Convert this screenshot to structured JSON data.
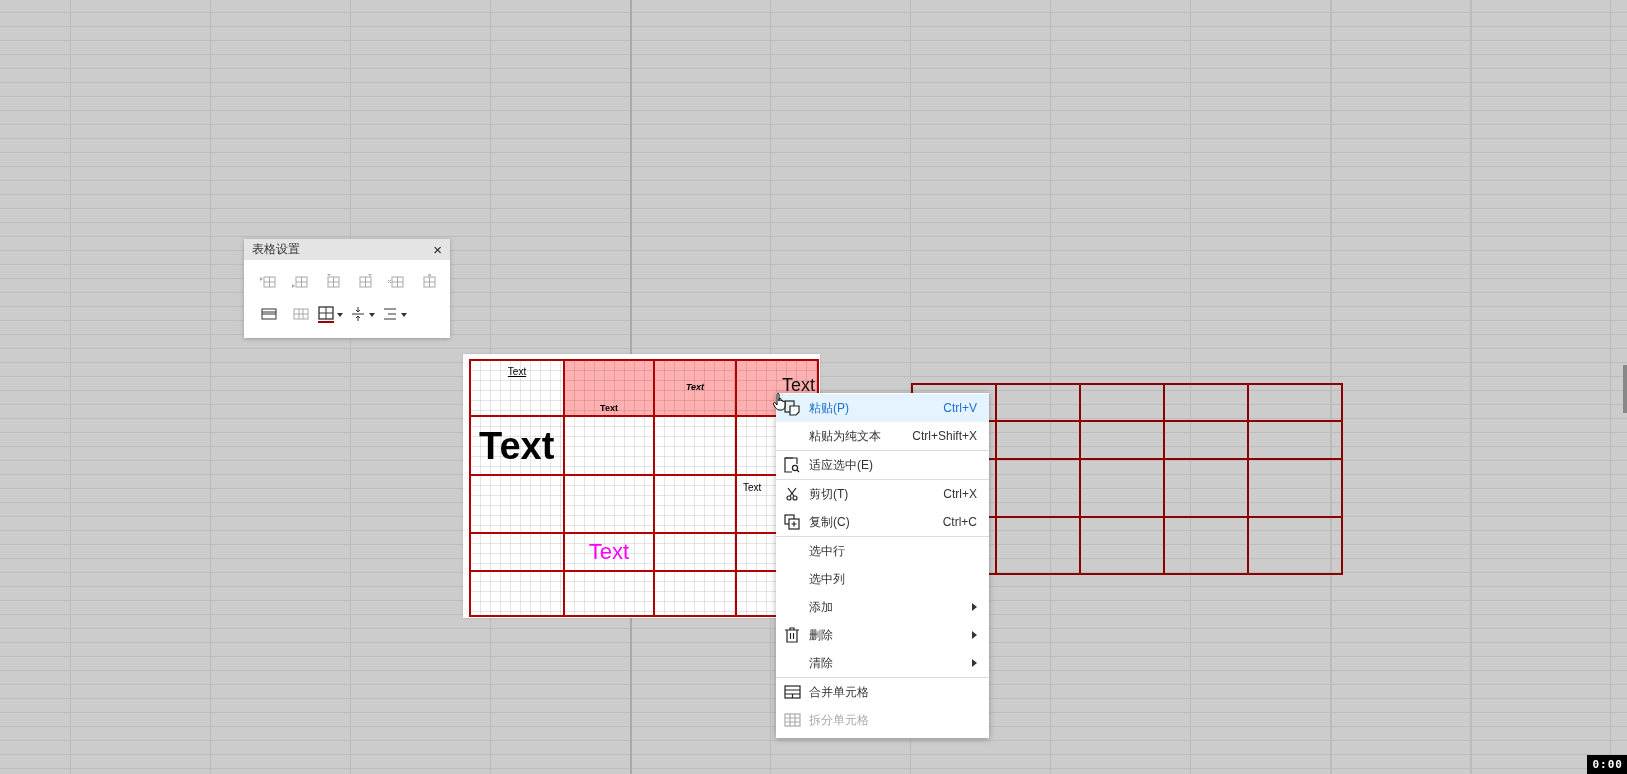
{
  "table_settings": {
    "title": "表格设置",
    "close": "×",
    "tools": [
      {
        "kind": "insert-column-left",
        "disabled": true
      },
      {
        "kind": "insert-column-right",
        "disabled": true
      },
      {
        "kind": "insert-row-above",
        "disabled": true
      },
      {
        "kind": "insert-row-below",
        "disabled": true
      },
      {
        "kind": "delete-row",
        "disabled": true
      },
      {
        "kind": "delete-column",
        "disabled": true
      },
      {
        "kind": "merge-cells",
        "disabled": false
      },
      {
        "kind": "split-cells",
        "disabled": true
      },
      {
        "kind": "borders",
        "disabled": false,
        "color": "#a00000"
      },
      {
        "kind": "vertical-align",
        "disabled": false
      },
      {
        "kind": "horizontal-align",
        "disabled": false
      }
    ]
  },
  "table": {
    "rows": [
      [
        {
          "text": "Text",
          "kind": "underlined",
          "selected": false
        },
        {
          "text": "Text",
          "kind": "bottom",
          "selected": true
        },
        {
          "text": "Text",
          "kind": "italic",
          "selected": true
        },
        {
          "text": "Text",
          "kind": "medium",
          "selected": true
        }
      ],
      [
        {
          "text": "Text",
          "kind": "huge",
          "selected": false
        },
        {
          "selected": false
        },
        {
          "selected": false
        },
        {
          "selected": false
        }
      ],
      [
        {
          "selected": false
        },
        {
          "selected": false
        },
        {
          "selected": false
        },
        {
          "text": "Text",
          "kind": "small",
          "selected": false
        }
      ],
      [
        {
          "selected": false
        },
        {
          "text": "Text",
          "kind": "magenta",
          "selected": false
        },
        {
          "selected": false
        },
        {
          "selected": false
        }
      ],
      [
        {
          "selected": false
        },
        {
          "selected": false
        },
        {
          "selected": false
        },
        {
          "selected": false
        }
      ]
    ]
  },
  "context_menu": {
    "sections": [
      [
        {
          "kind": "paste",
          "label": "粘贴(P)",
          "shortcut": "Ctrl+V",
          "selected": true,
          "disabled": false,
          "submenu": false
        },
        {
          "kind": "plain",
          "label": "粘贴为纯文本",
          "shortcut": "Ctrl+Shift+X",
          "selected": false,
          "disabled": false,
          "submenu": false
        }
      ],
      [
        {
          "kind": "fit",
          "label": "适应选中(E)",
          "selected": false,
          "disabled": false,
          "submenu": false
        }
      ],
      [
        {
          "kind": "cut",
          "label": "剪切(T)",
          "shortcut": "Ctrl+X",
          "selected": false,
          "disabled": false,
          "submenu": false
        },
        {
          "kind": "copy",
          "label": "复制(C)",
          "shortcut": "Ctrl+C",
          "selected": false,
          "disabled": false,
          "submenu": false
        }
      ],
      [
        {
          "kind": "plain",
          "label": "选中行",
          "selected": false,
          "disabled": false,
          "submenu": false
        },
        {
          "kind": "plain",
          "label": "选中列",
          "selected": false,
          "disabled": false,
          "submenu": false
        },
        {
          "kind": "plain",
          "label": "添加",
          "selected": false,
          "disabled": false,
          "submenu": true
        },
        {
          "kind": "delete",
          "label": "删除",
          "selected": false,
          "disabled": false,
          "submenu": true
        },
        {
          "kind": "plain",
          "label": "清除",
          "selected": false,
          "disabled": false,
          "submenu": true
        }
      ],
      [
        {
          "kind": "merge",
          "label": "合并单元格",
          "selected": false,
          "disabled": false,
          "submenu": false
        },
        {
          "kind": "split",
          "label": "拆分单元格",
          "selected": false,
          "disabled": true,
          "submenu": false
        }
      ]
    ]
  },
  "timer": "0:00"
}
